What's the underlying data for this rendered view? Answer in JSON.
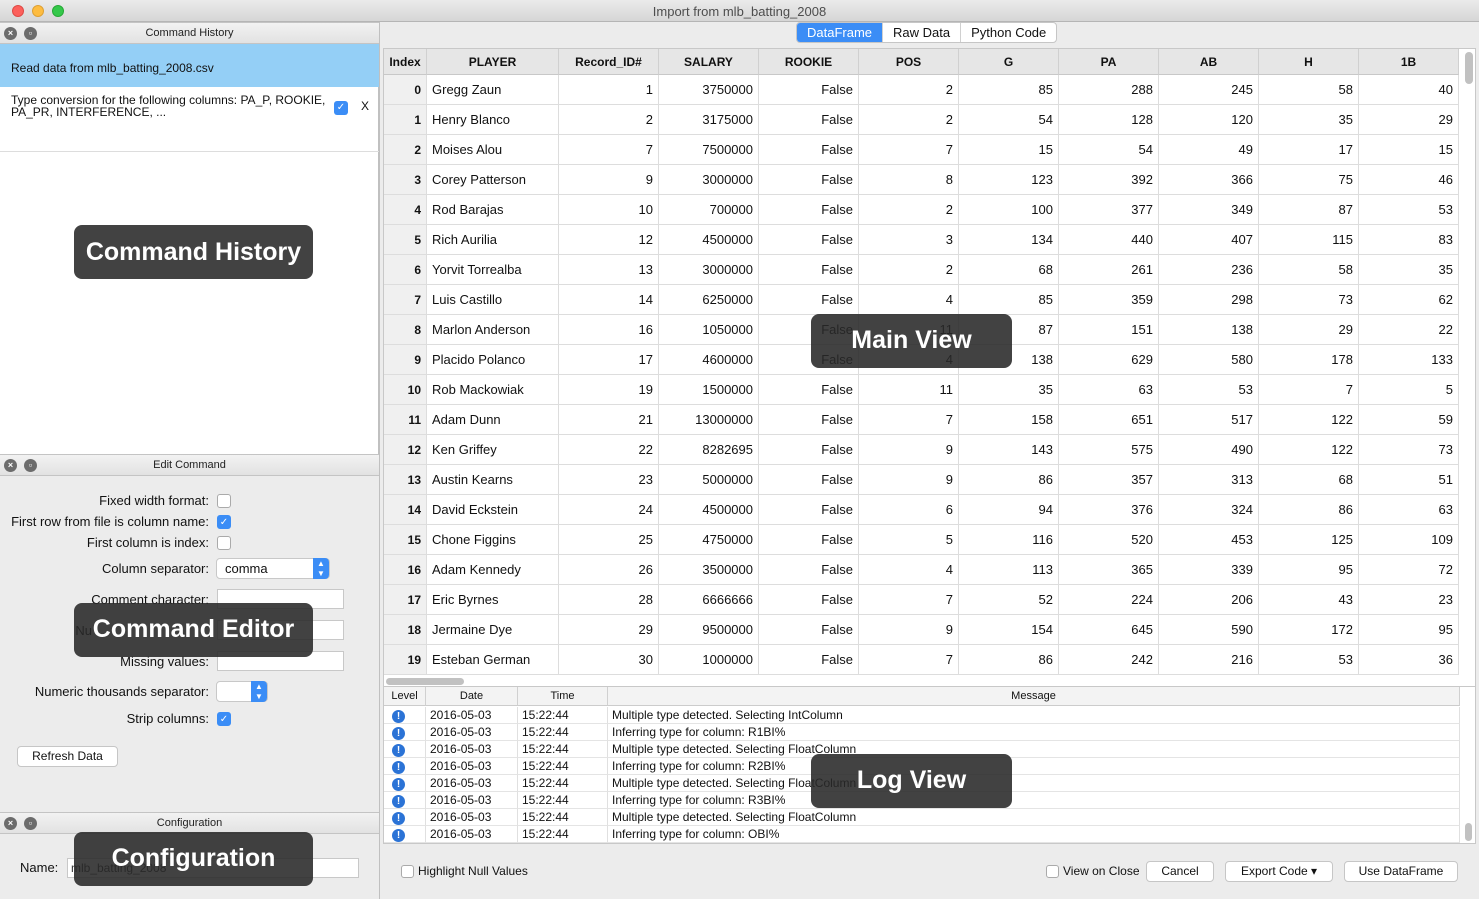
{
  "window": {
    "title": "Import from mlb_batting_2008"
  },
  "left": {
    "history": {
      "title": "Command History",
      "items": [
        {
          "text": "Read data from mlb_batting_2008.csv"
        },
        {
          "text": "Type conversion for the following columns: PA_P, ROOKIE, PA_PR, INTERFERENCE, ...",
          "remove": "X"
        }
      ]
    },
    "edit": {
      "title": "Edit Command",
      "fixed_width_label": "Fixed width format:",
      "first_row_label": "First row from file is column name:",
      "first_col_label": "First column is index:",
      "separator_label": "Column separator:",
      "separator_value": "comma",
      "comment_label": "Comment character:",
      "num_label": "Nu",
      "missing_label": "Missing values:",
      "thousands_label": "Numeric thousands separator:",
      "strip_label": "Strip columns:",
      "refresh_button": "Refresh Data"
    },
    "config": {
      "title": "Configuration",
      "name_label": "Name:",
      "name_value": "mlb_batting_2008"
    }
  },
  "overlays": {
    "history": "Command History",
    "editor": "Command Editor",
    "config": "Configuration",
    "main": "Main View",
    "log": "Log View"
  },
  "tabs": [
    {
      "label": "DataFrame",
      "active": true
    },
    {
      "label": "Raw Data",
      "active": false
    },
    {
      "label": "Python Code",
      "active": false
    }
  ],
  "table": {
    "columns": [
      "Index",
      "PLAYER",
      "Record_ID#",
      "SALARY",
      "ROOKIE",
      "POS",
      "G",
      "PA",
      "AB",
      "H",
      "1B"
    ],
    "rows": [
      [
        "0",
        "Gregg Zaun",
        "1",
        "3750000",
        "False",
        "2",
        "85",
        "288",
        "245",
        "58",
        "40"
      ],
      [
        "1",
        "Henry Blanco",
        "2",
        "3175000",
        "False",
        "2",
        "54",
        "128",
        "120",
        "35",
        "29"
      ],
      [
        "2",
        "Moises Alou",
        "7",
        "7500000",
        "False",
        "7",
        "15",
        "54",
        "49",
        "17",
        "15"
      ],
      [
        "3",
        "Corey Patterson",
        "9",
        "3000000",
        "False",
        "8",
        "123",
        "392",
        "366",
        "75",
        "46"
      ],
      [
        "4",
        "Rod Barajas",
        "10",
        "700000",
        "False",
        "2",
        "100",
        "377",
        "349",
        "87",
        "53"
      ],
      [
        "5",
        "Rich Aurilia",
        "12",
        "4500000",
        "False",
        "3",
        "134",
        "440",
        "407",
        "115",
        "83"
      ],
      [
        "6",
        "Yorvit Torrealba",
        "13",
        "3000000",
        "False",
        "2",
        "68",
        "261",
        "236",
        "58",
        "35"
      ],
      [
        "7",
        "Luis Castillo",
        "14",
        "6250000",
        "False",
        "4",
        "85",
        "359",
        "298",
        "73",
        "62"
      ],
      [
        "8",
        "Marlon Anderson",
        "16",
        "1050000",
        "False",
        "11",
        "87",
        "151",
        "138",
        "29",
        "22"
      ],
      [
        "9",
        "Placido Polanco",
        "17",
        "4600000",
        "False",
        "4",
        "138",
        "629",
        "580",
        "178",
        "133"
      ],
      [
        "10",
        "Rob Mackowiak",
        "19",
        "1500000",
        "False",
        "11",
        "35",
        "63",
        "53",
        "7",
        "5"
      ],
      [
        "11",
        "Adam Dunn",
        "21",
        "13000000",
        "False",
        "7",
        "158",
        "651",
        "517",
        "122",
        "59"
      ],
      [
        "12",
        "Ken Griffey",
        "22",
        "8282695",
        "False",
        "9",
        "143",
        "575",
        "490",
        "122",
        "73"
      ],
      [
        "13",
        "Austin Kearns",
        "23",
        "5000000",
        "False",
        "9",
        "86",
        "357",
        "313",
        "68",
        "51"
      ],
      [
        "14",
        "David Eckstein",
        "24",
        "4500000",
        "False",
        "6",
        "94",
        "376",
        "324",
        "86",
        "63"
      ],
      [
        "15",
        "Chone Figgins",
        "25",
        "4750000",
        "False",
        "5",
        "116",
        "520",
        "453",
        "125",
        "109"
      ],
      [
        "16",
        "Adam Kennedy",
        "26",
        "3500000",
        "False",
        "4",
        "113",
        "365",
        "339",
        "95",
        "72"
      ],
      [
        "17",
        "Eric Byrnes",
        "28",
        "6666666",
        "False",
        "7",
        "52",
        "224",
        "206",
        "43",
        "23"
      ],
      [
        "18",
        "Jermaine Dye",
        "29",
        "9500000",
        "False",
        "9",
        "154",
        "645",
        "590",
        "172",
        "95"
      ],
      [
        "19",
        "Esteban German",
        "30",
        "1000000",
        "False",
        "7",
        "86",
        "242",
        "216",
        "53",
        "36"
      ]
    ]
  },
  "log": {
    "columns": [
      "Level",
      "Date",
      "Time",
      "Message"
    ],
    "rows": [
      [
        "2016-05-03",
        "15:22:44",
        "Multiple type detected. Selecting IntColumn"
      ],
      [
        "2016-05-03",
        "15:22:44",
        "Inferring type for column: R1BI%"
      ],
      [
        "2016-05-03",
        "15:22:44",
        "Multiple type detected. Selecting FloatColumn"
      ],
      [
        "2016-05-03",
        "15:22:44",
        "Inferring type for column: R2BI%"
      ],
      [
        "2016-05-03",
        "15:22:44",
        "Multiple type detected. Selecting FloatColumn"
      ],
      [
        "2016-05-03",
        "15:22:44",
        "Inferring type for column: R3BI%"
      ],
      [
        "2016-05-03",
        "15:22:44",
        "Multiple type detected. Selecting FloatColumn"
      ],
      [
        "2016-05-03",
        "15:22:44",
        "Inferring type for column: OBI%"
      ]
    ]
  },
  "bottom": {
    "highlight_null": "Highlight Null Values",
    "view_on_close": "View on Close",
    "cancel": "Cancel",
    "export_code": "Export Code ▾",
    "use_dataframe": "Use DataFrame"
  }
}
